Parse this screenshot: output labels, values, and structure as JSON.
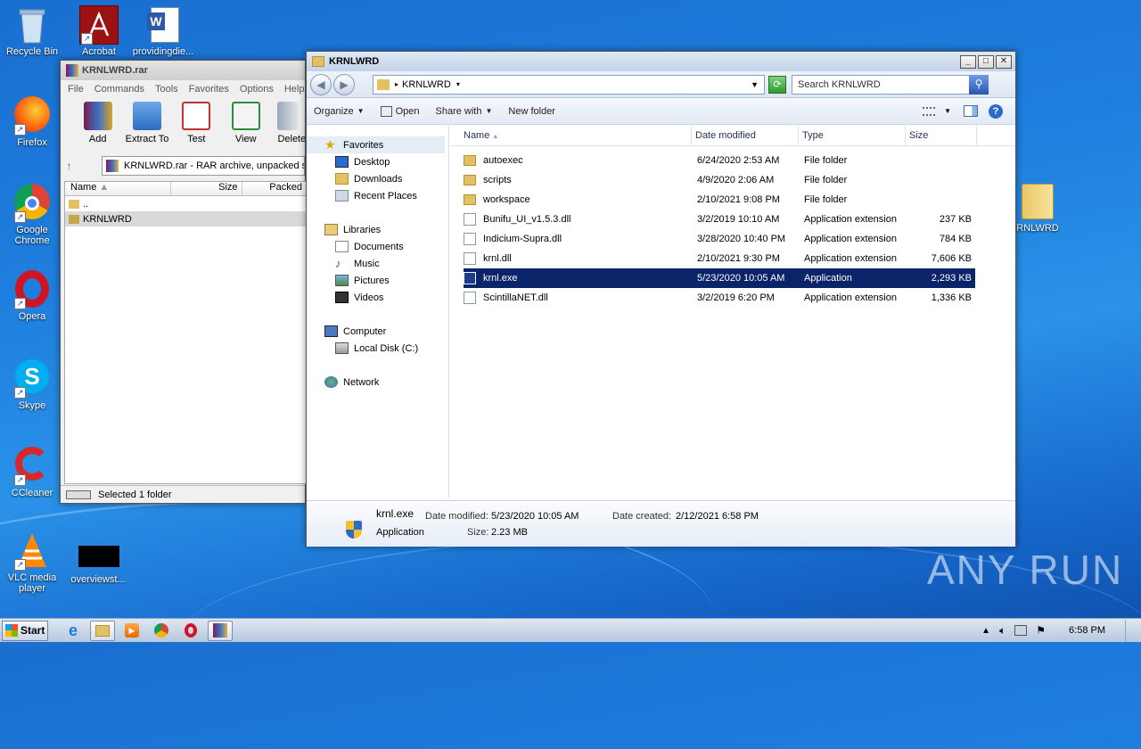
{
  "desktop": {
    "icons": [
      {
        "label": "Recycle Bin",
        "icon": "recycle-bin-icon"
      },
      {
        "label": "Acrobat",
        "icon": "acrobat-icon"
      },
      {
        "label": "providingdie...",
        "icon": "word-doc-icon"
      },
      {
        "label": "Firefox",
        "icon": "firefox-icon"
      },
      {
        "label": "Google Chrome",
        "icon": "chrome-icon"
      },
      {
        "label": "Opera",
        "icon": "opera-icon"
      },
      {
        "label": "Skype",
        "icon": "skype-icon"
      },
      {
        "label": "CCleaner",
        "icon": "ccleaner-icon"
      },
      {
        "label": "VLC media player",
        "icon": "vlc-icon"
      },
      {
        "label": "overviewst...",
        "icon": "black-file-icon"
      },
      {
        "label": "RNLWRD",
        "icon": "folder-icon"
      }
    ],
    "watermark": "ANY RUN"
  },
  "winrar": {
    "title": "KRNLWRD.rar",
    "menu": [
      "File",
      "Commands",
      "Tools",
      "Favorites",
      "Options",
      "Help"
    ],
    "toolbar": [
      "Add",
      "Extract To",
      "Test",
      "View",
      "Delete"
    ],
    "path_text": "KRNLWRD.rar - RAR archive, unpacked s",
    "columns": [
      "Name",
      "Size",
      "Packed"
    ],
    "rows": [
      "..",
      "KRNLWRD"
    ],
    "status": "Selected 1 folder"
  },
  "explorer": {
    "title": "KRNLWRD",
    "address": "KRNLWRD",
    "search_placeholder": "Search KRNLWRD",
    "toolbar": {
      "organize": "Organize",
      "open": "Open",
      "share": "Share with",
      "new_folder": "New folder"
    },
    "nav": {
      "favorites": "Favorites",
      "desktop": "Desktop",
      "downloads": "Downloads",
      "recent": "Recent Places",
      "libraries": "Libraries",
      "documents": "Documents",
      "music": "Music",
      "pictures": "Pictures",
      "videos": "Videos",
      "computer": "Computer",
      "local_disk": "Local Disk (C:)",
      "network": "Network"
    },
    "columns": [
      "Name",
      "Date modified",
      "Type",
      "Size"
    ],
    "files": [
      {
        "name": "autoexec",
        "date": "6/24/2020 2:53 AM",
        "type": "File folder",
        "size": ""
      },
      {
        "name": "scripts",
        "date": "4/9/2020 2:06 AM",
        "type": "File folder",
        "size": ""
      },
      {
        "name": "workspace",
        "date": "2/10/2021 9:08 PM",
        "type": "File folder",
        "size": ""
      },
      {
        "name": "Bunifu_UI_v1.5.3.dll",
        "date": "3/2/2019 10:10 AM",
        "type": "Application extension",
        "size": "237 KB"
      },
      {
        "name": "Indicium-Supra.dll",
        "date": "3/28/2020 10:40 PM",
        "type": "Application extension",
        "size": "784 KB"
      },
      {
        "name": "krnl.dll",
        "date": "2/10/2021 9:30 PM",
        "type": "Application extension",
        "size": "7,606 KB"
      },
      {
        "name": "krnl.exe",
        "date": "5/23/2020 10:05 AM",
        "type": "Application",
        "size": "2,293 KB"
      },
      {
        "name": "ScintillaNET.dll",
        "date": "3/2/2019 6:20 PM",
        "type": "Application extension",
        "size": "1,336 KB"
      }
    ],
    "details": {
      "name": "krnl.exe",
      "kind": "Application",
      "modified_label": "Date modified:",
      "modified": "5/23/2020 10:05 AM",
      "created_label": "Date created:",
      "created": "2/12/2021 6:58 PM",
      "size_label": "Size:",
      "size": "2.23 MB"
    }
  },
  "taskbar": {
    "start": "Start",
    "clock": "6:58 PM"
  }
}
